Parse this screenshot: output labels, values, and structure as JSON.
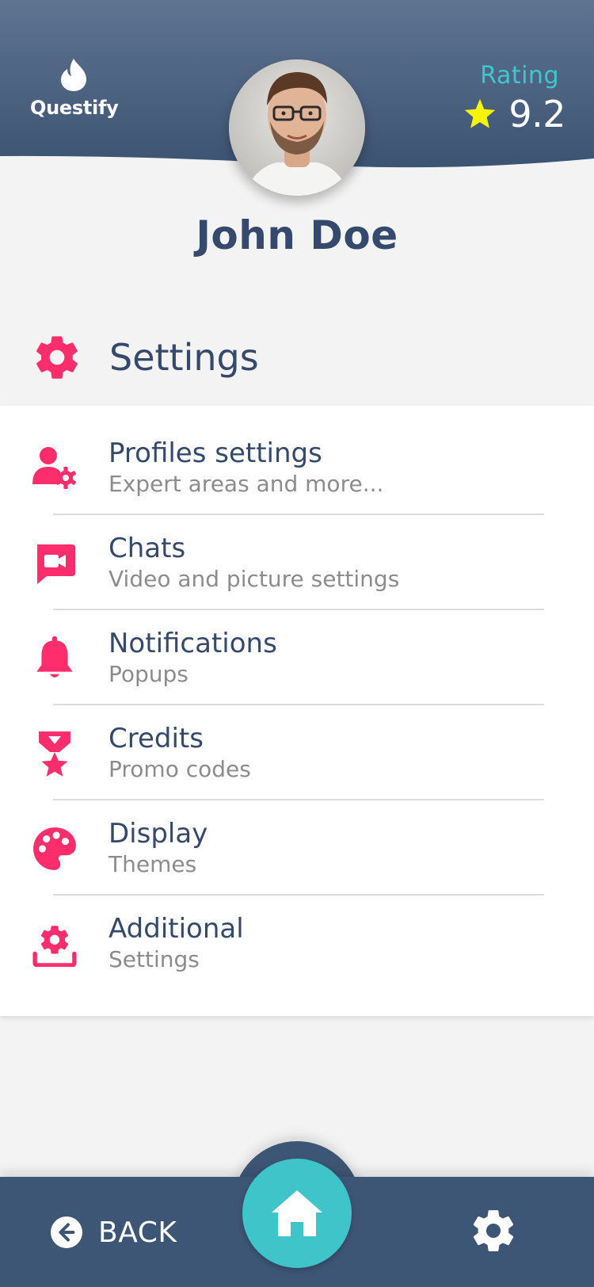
{
  "app": {
    "name": "Questify"
  },
  "header": {
    "rating_label": "Rating",
    "rating_value": "9.2"
  },
  "user": {
    "name": "John Doe"
  },
  "section": {
    "title": "Settings"
  },
  "menu": [
    {
      "label": "Profiles settings",
      "sub": "Expert areas and more...",
      "icon": "user-cog-icon"
    },
    {
      "label": "Chats",
      "sub": "Video and picture settings",
      "icon": "video-chat-icon"
    },
    {
      "label": "Notifications",
      "sub": "Popups",
      "icon": "bell-icon"
    },
    {
      "label": "Credits",
      "sub": "Promo codes",
      "icon": "medal-icon"
    },
    {
      "label": "Display",
      "sub": "Themes",
      "icon": "palette-icon"
    },
    {
      "label": "Additional",
      "sub": "Settings",
      "icon": "gear-tray-icon"
    }
  ],
  "bottom_nav": {
    "back_label": "BACK"
  },
  "colors": {
    "header": "#3e5676",
    "accent": "#ff2d6b",
    "teal": "#3ec4c9",
    "star": "#f5f500"
  }
}
